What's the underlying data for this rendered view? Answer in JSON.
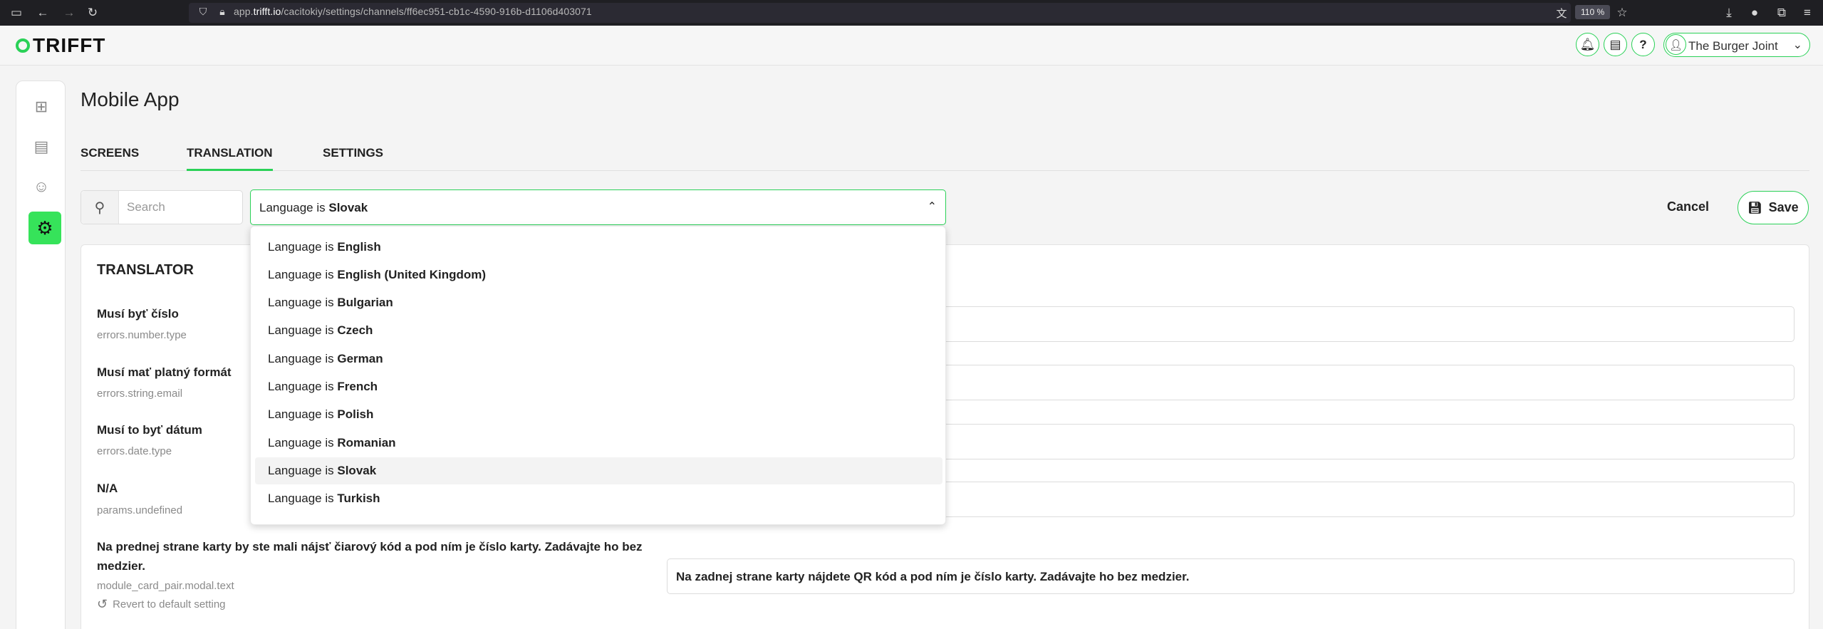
{
  "browser": {
    "url_prefix": "app.",
    "url_domain": "trifft.io",
    "url_path": "/cacitokiy/settings/channels/ff6ec951-cb1c-4590-916b-d1106d403071",
    "zoom": "110 %"
  },
  "header": {
    "logo": "TRIFFT",
    "account_name": "The Burger Joint"
  },
  "page": {
    "title": "Mobile App",
    "tabs": [
      {
        "label": "SCREENS"
      },
      {
        "label": "TRANSLATION",
        "active": true
      },
      {
        "label": "SETTINGS"
      }
    ]
  },
  "toolbar": {
    "search_placeholder": "Search",
    "language_prefix": "Language is",
    "language_selected": "Slovak",
    "cancel_label": "Cancel",
    "save_label": "Save"
  },
  "dropdown": {
    "options": [
      {
        "prefix": "Language is",
        "lang": "English"
      },
      {
        "prefix": "Language is",
        "lang": "English (United Kingdom)"
      },
      {
        "prefix": "Language is",
        "lang": "Bulgarian"
      },
      {
        "prefix": "Language is",
        "lang": "Czech"
      },
      {
        "prefix": "Language is",
        "lang": "German"
      },
      {
        "prefix": "Language is",
        "lang": "French"
      },
      {
        "prefix": "Language is",
        "lang": "Polish"
      },
      {
        "prefix": "Language is",
        "lang": "Romanian"
      },
      {
        "prefix": "Language is",
        "lang": "Slovak",
        "selected": true
      },
      {
        "prefix": "Language is",
        "lang": "Turkish"
      }
    ]
  },
  "translator": {
    "title": "TRANSLATOR",
    "rows": [
      {
        "label": "Musí byť číslo",
        "key": "errors.number.type"
      },
      {
        "label": "Musí mať platný formát",
        "key": "errors.string.email"
      },
      {
        "label": "Musí to byť dátum",
        "key": "errors.date.type"
      },
      {
        "label": "N/A",
        "key": "params.undefined"
      }
    ],
    "long_row": {
      "label": "Na prednej strane karty by ste mali nájsť čiarový kód a pod ním je číslo karty. Zadávajte ho bez medzier.",
      "key": "module_card_pair.modal.text",
      "value": "Na zadnej strane karty nájdete QR kód a pod ním je číslo karty. Zadávajte ho bez medzier.",
      "revert_label": "Revert to default setting"
    }
  },
  "colors": {
    "accent": "#2ad157",
    "active_rail": "#36e35a"
  }
}
